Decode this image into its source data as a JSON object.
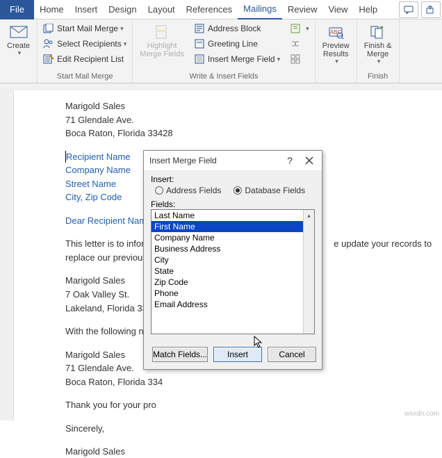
{
  "tabs": {
    "file": "File",
    "items": [
      "Home",
      "Insert",
      "Design",
      "Layout",
      "References",
      "Mailings",
      "Review",
      "View",
      "Help"
    ],
    "active_index": 5
  },
  "ribbon": {
    "create": {
      "label": "Create"
    },
    "start_group": {
      "label": "Start Mail Merge",
      "start": "Start Mail Merge",
      "select": "Select Recipients",
      "edit": "Edit Recipient List"
    },
    "write_group": {
      "label": "Write & Insert Fields",
      "highlight": "Highlight\nMerge Fields",
      "address": "Address Block",
      "greeting": "Greeting Line",
      "insert_field": "Insert Merge Field"
    },
    "preview_group": {
      "label": "",
      "preview": "Preview\nResults"
    },
    "finish_group": {
      "label": "Finish",
      "finish": "Finish &\nMerge"
    }
  },
  "doc": {
    "sender_name": "Marigold Sales",
    "sender_addr1": "71 Glendale Ave.",
    "sender_addr2": "Boca Raton, Florida 33428",
    "recip_name": "Recipient Name",
    "recip_company": "Company Name",
    "recip_street": "Street Name",
    "recip_city": "City, Zip Code",
    "greeting": "Dear Recipient Name,",
    "para1a": "This letter is to inform",
    "para1b": "e update your records to",
    "para2": "replace our previous a",
    "old_name": "Marigold Sales",
    "old_addr1": "7 Oak Valley St.",
    "old_addr2": "Lakeland, Florida 3380",
    "with_line": "With the following new",
    "new_name": "Marigold Sales",
    "new_addr1": "71 Glendale Ave.",
    "new_addr2": "Boca Raton, Florida 334",
    "thanks": "Thank you for your pro",
    "closing": "Sincerely,",
    "sig": "Marigold Sales"
  },
  "dialog": {
    "title": "Insert Merge Field",
    "insert_label": "Insert:",
    "radio_address": "Address Fields",
    "radio_database": "Database Fields",
    "fields_label": "Fields:",
    "items": [
      "Last Name",
      "First Name",
      "Company Name",
      "Business Address",
      "City",
      "State",
      "Zip Code",
      "Phone",
      "Email Address"
    ],
    "selected_index": 1,
    "btn_match": "Match Fields...",
    "btn_insert": "Insert",
    "btn_cancel": "Cancel"
  },
  "watermark": "wsxdn.com"
}
